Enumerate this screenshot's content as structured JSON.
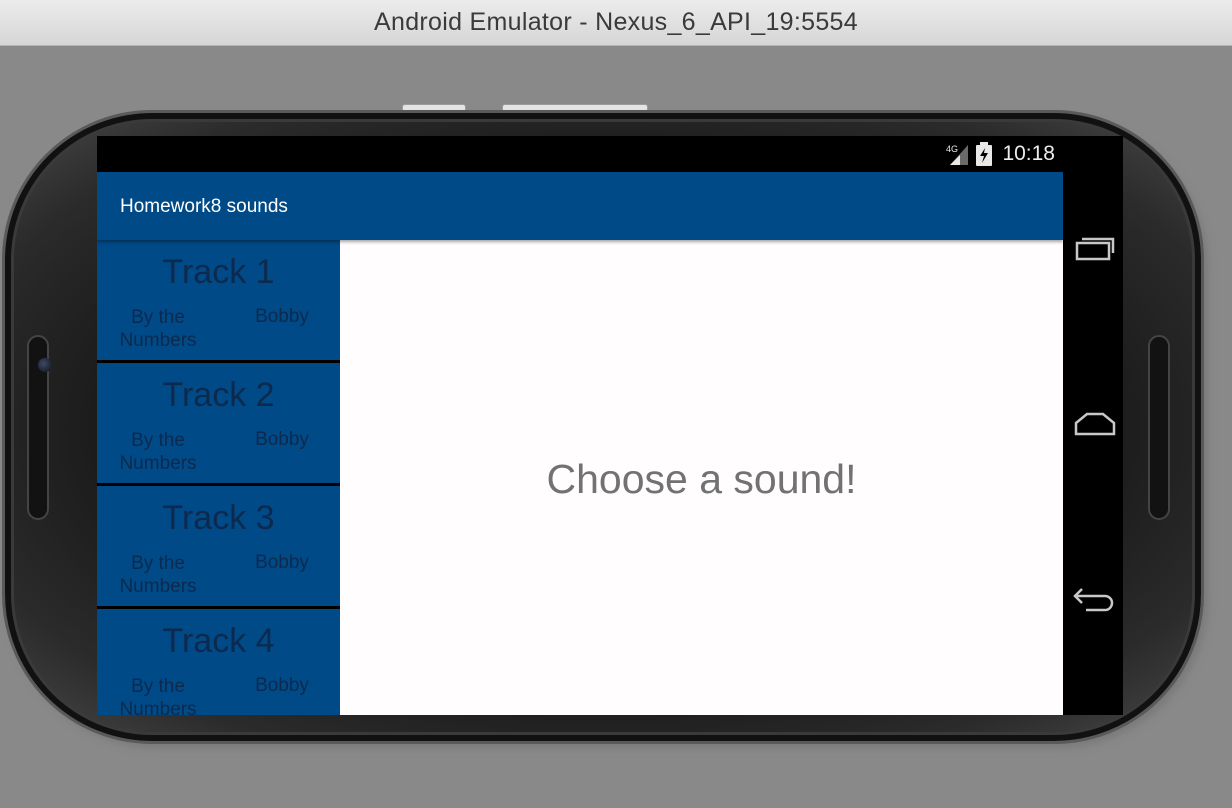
{
  "window": {
    "title": "Android Emulator - Nexus_6_API_19:5554"
  },
  "status_bar": {
    "network_label": "4G",
    "time": "10:18",
    "icons": [
      "signal-icon",
      "battery-charging-icon"
    ]
  },
  "action_bar": {
    "title": "Homework8 sounds",
    "color": "#004a87"
  },
  "tracks": [
    {
      "title": "Track 1",
      "album": "By the Numbers",
      "artist": "Bobby"
    },
    {
      "title": "Track 2",
      "album": "By the Numbers",
      "artist": "Bobby"
    },
    {
      "title": "Track 3",
      "album": "By the Numbers",
      "artist": "Bobby"
    },
    {
      "title": "Track 4",
      "album": "By the Numbers",
      "artist": "Bobby"
    }
  ],
  "detail": {
    "prompt": "Choose a sound!"
  },
  "nav_buttons": [
    "recent-apps-icon",
    "home-icon",
    "back-icon"
  ]
}
